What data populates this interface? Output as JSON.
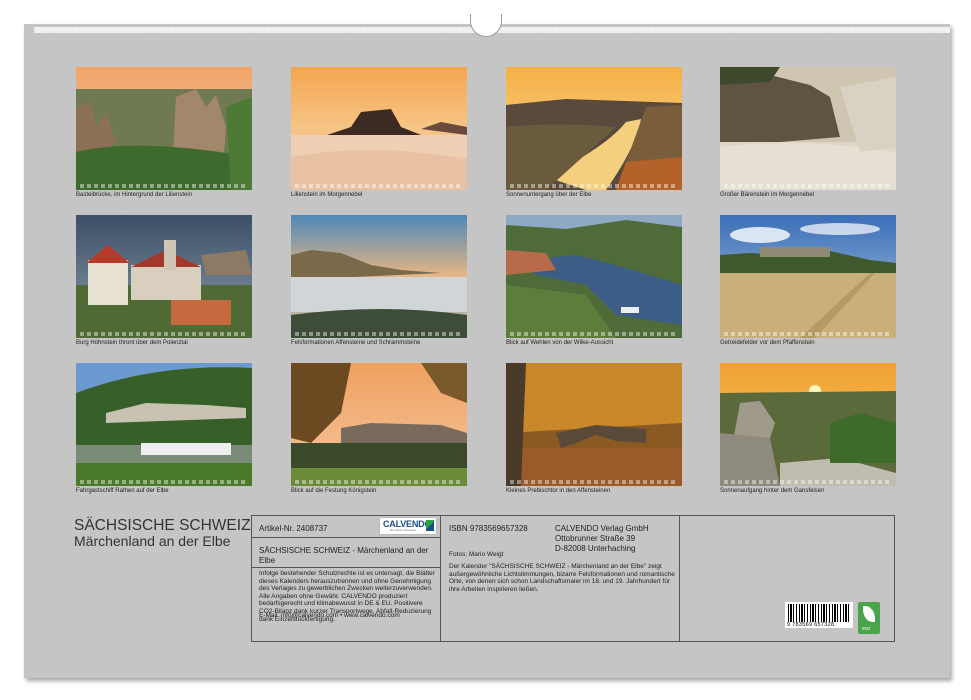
{
  "photos": [
    {
      "caption": "Basteibrücke, im Hintergrund der Lilienstein"
    },
    {
      "caption": "Lilienstein im Morgennebel"
    },
    {
      "caption": "Sonnenuntergang über der Elbe"
    },
    {
      "caption": "Großer Bärenstein im Morgennebel"
    },
    {
      "caption": "Burg Hohnstein thront über dem Polenztal"
    },
    {
      "caption": "Felsformationen Affensteine und Schrammsteine"
    },
    {
      "caption": "Blick auf Wehlen von der Wilke-Aussicht"
    },
    {
      "caption": "Getreidefelder vor dem Pfaffenstein"
    },
    {
      "caption": "Fahrgastschiff Rathen auf der Elbe"
    },
    {
      "caption": "Blick auf die Festung Königstein"
    },
    {
      "caption": "Kleines Prebischtor in den Affensteinen"
    },
    {
      "caption": "Sonnenaufgang hinter dem Gansfelsen"
    }
  ],
  "title": "SÄCHSISCHE SCHWEIZ",
  "subtitle": "Märchenland an der Elbe",
  "article": "Artikel-Nr. 2408737",
  "logo_text": "CALVENDO",
  "logo_sub": "Die Welt entdecken",
  "product_title": "SÄCHSISCHE SCHWEIZ - Märchenland an der Elbe",
  "legal_text": "Infolge bestehender Schutzrechte ist es untersagt, die Blätter dieses Kalenders herauszutrennen und ohne Genehmigung des Verlages zu gewerblichen Zwecken weiterzuverwenden. Alle Angaben ohne Gewähr. CALVENDO produziert bedarfsgerecht und klimabewusst in DE & EU. Positivere CO2-Bilanz dank kurzer Transportwege. Abfall-Reduzierung dank Einzelstückfertigung.",
  "email": "E-Mail: info@calvendo.com • www.calvendo.com",
  "isbn": "ISBN 9783569657328",
  "photographer": "Fotos: Mario Weigt",
  "description": "Der Kalender \"SÄCHSISCHE SCHWEIZ - Märchenland an der Elbe\" zeigt außergewöhnliche Lichtstimmungen, bizarre Felsformationen und romantische Orte, von denen sich schon Landschaftsmaler im 18. und 19. Jahrhundert für ihre Arbeiten inspirieren ließen.",
  "publisher": {
    "name": "CALVENDO Verlag GmbH",
    "street": "Ottobrunner Straße 39",
    "city": "D-82008 Unterhaching"
  },
  "barcode_number": "9 783569 657328",
  "eco_label": "eco",
  "colors": {
    "page": "#c5c5c5",
    "text": "#222222",
    "logo_blue": "#1d4e8a",
    "eco_green": "#4aa54a"
  }
}
